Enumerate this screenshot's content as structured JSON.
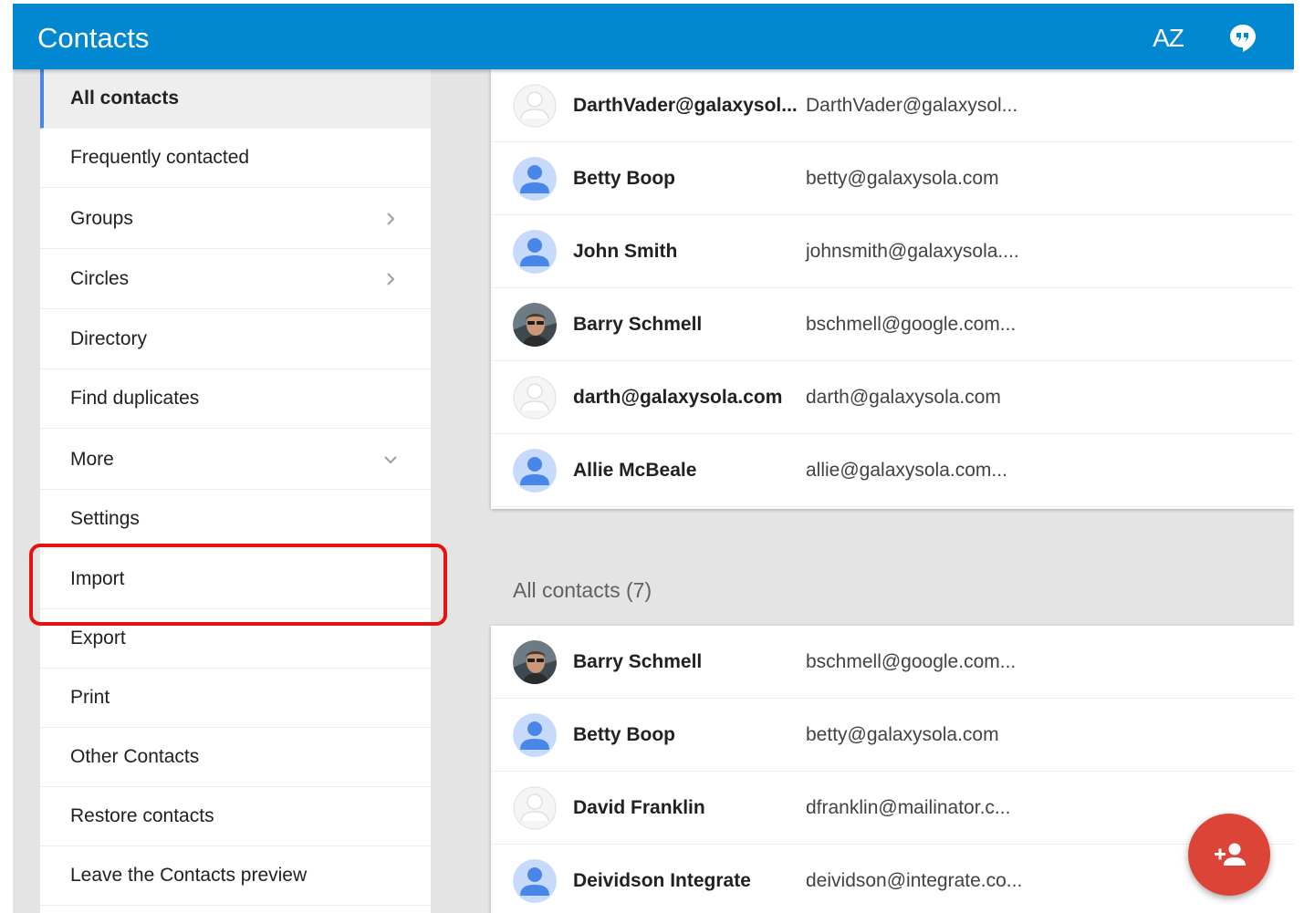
{
  "header": {
    "title": "Contacts",
    "sort_label": "AZ",
    "sort_icon": "sort-az-icon",
    "feedback_icon": "feedback-icon"
  },
  "sidebar": {
    "items": [
      {
        "label": "All contacts",
        "active": true
      },
      {
        "label": "Frequently contacted"
      },
      {
        "label": "Groups",
        "icon": "chevron-right-icon"
      },
      {
        "label": "Circles",
        "icon": "chevron-right-icon"
      },
      {
        "label": "Directory"
      },
      {
        "label": "Find duplicates"
      },
      {
        "label": "More",
        "icon": "chevron-down-icon"
      },
      {
        "label": "Settings"
      },
      {
        "label": "Import"
      },
      {
        "label": "Export"
      },
      {
        "label": "Print"
      },
      {
        "label": "Other Contacts"
      },
      {
        "label": "Restore contacts"
      },
      {
        "label": "Leave the Contacts preview"
      }
    ]
  },
  "frequent_contacts": [
    {
      "name": "DarthVader@galaxysol...",
      "email": "DarthVader@galaxysol...",
      "avatar": "empty"
    },
    {
      "name": "Betty Boop",
      "email": "betty@galaxysola.com",
      "avatar": "blue"
    },
    {
      "name": "John Smith",
      "email": "johnsmith@galaxysola....",
      "avatar": "blue"
    },
    {
      "name": "Barry Schmell",
      "email": "bschmell@google.com...",
      "avatar": "photo"
    },
    {
      "name": "darth@galaxysola.com",
      "email": "darth@galaxysola.com",
      "avatar": "empty"
    },
    {
      "name": "Allie McBeale",
      "email": "allie@galaxysola.com...",
      "avatar": "blue"
    }
  ],
  "all_contacts": {
    "label": "All contacts (7)",
    "rows": [
      {
        "name": "Barry Schmell",
        "email": "bschmell@google.com...",
        "avatar": "photo"
      },
      {
        "name": "Betty Boop",
        "email": "betty@galaxysola.com",
        "avatar": "blue"
      },
      {
        "name": "David Franklin",
        "email": "dfranklin@mailinator.c...",
        "avatar": "empty"
      },
      {
        "name": "Deividson Integrate",
        "email": "deividson@integrate.co...",
        "avatar": "blue"
      }
    ]
  },
  "fab": {
    "icon": "add-contact-icon"
  },
  "colors": {
    "header": "#0288d1",
    "accent": "#4a86e8",
    "fab": "#db4437",
    "highlight": "#e81111",
    "avatar_blue": "#4a86e8"
  }
}
